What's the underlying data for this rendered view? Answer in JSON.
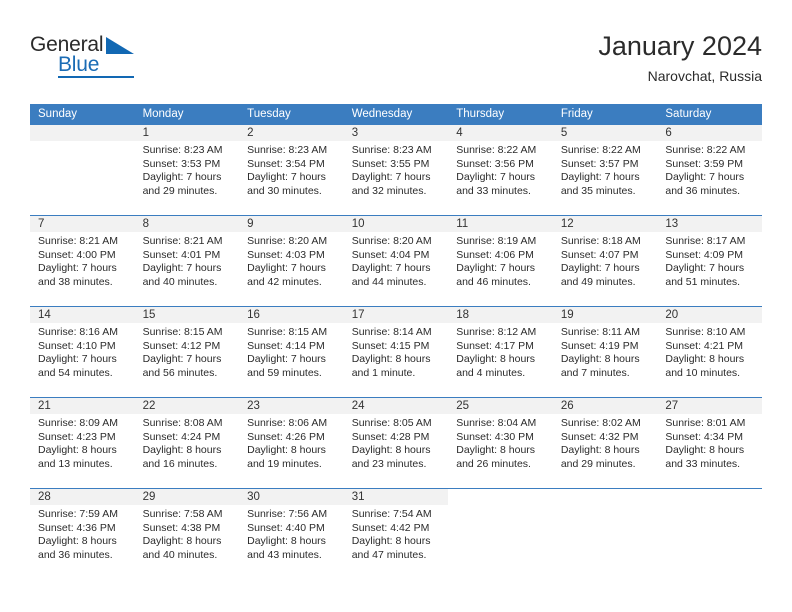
{
  "brand": {
    "general": "General",
    "blue": "Blue"
  },
  "header": {
    "title": "January 2024",
    "subtitle": "Narovchat, Russia"
  },
  "colors": {
    "header_blue": "#3b7dc0",
    "brand_blue": "#1268b3",
    "daynum_band": "#f2f2f2",
    "text": "#2b2b2b"
  },
  "calendar": {
    "weekday_headers": [
      "Sunday",
      "Monday",
      "Tuesday",
      "Wednesday",
      "Thursday",
      "Friday",
      "Saturday"
    ],
    "weeks": [
      [
        {
          "day": "",
          "lines": []
        },
        {
          "day": "1",
          "lines": [
            "Sunrise: 8:23 AM",
            "Sunset: 3:53 PM",
            "Daylight: 7 hours",
            "and 29 minutes."
          ]
        },
        {
          "day": "2",
          "lines": [
            "Sunrise: 8:23 AM",
            "Sunset: 3:54 PM",
            "Daylight: 7 hours",
            "and 30 minutes."
          ]
        },
        {
          "day": "3",
          "lines": [
            "Sunrise: 8:23 AM",
            "Sunset: 3:55 PM",
            "Daylight: 7 hours",
            "and 32 minutes."
          ]
        },
        {
          "day": "4",
          "lines": [
            "Sunrise: 8:22 AM",
            "Sunset: 3:56 PM",
            "Daylight: 7 hours",
            "and 33 minutes."
          ]
        },
        {
          "day": "5",
          "lines": [
            "Sunrise: 8:22 AM",
            "Sunset: 3:57 PM",
            "Daylight: 7 hours",
            "and 35 minutes."
          ]
        },
        {
          "day": "6",
          "lines": [
            "Sunrise: 8:22 AM",
            "Sunset: 3:59 PM",
            "Daylight: 7 hours",
            "and 36 minutes."
          ]
        }
      ],
      [
        {
          "day": "7",
          "lines": [
            "Sunrise: 8:21 AM",
            "Sunset: 4:00 PM",
            "Daylight: 7 hours",
            "and 38 minutes."
          ]
        },
        {
          "day": "8",
          "lines": [
            "Sunrise: 8:21 AM",
            "Sunset: 4:01 PM",
            "Daylight: 7 hours",
            "and 40 minutes."
          ]
        },
        {
          "day": "9",
          "lines": [
            "Sunrise: 8:20 AM",
            "Sunset: 4:03 PM",
            "Daylight: 7 hours",
            "and 42 minutes."
          ]
        },
        {
          "day": "10",
          "lines": [
            "Sunrise: 8:20 AM",
            "Sunset: 4:04 PM",
            "Daylight: 7 hours",
            "and 44 minutes."
          ]
        },
        {
          "day": "11",
          "lines": [
            "Sunrise: 8:19 AM",
            "Sunset: 4:06 PM",
            "Daylight: 7 hours",
            "and 46 minutes."
          ]
        },
        {
          "day": "12",
          "lines": [
            "Sunrise: 8:18 AM",
            "Sunset: 4:07 PM",
            "Daylight: 7 hours",
            "and 49 minutes."
          ]
        },
        {
          "day": "13",
          "lines": [
            "Sunrise: 8:17 AM",
            "Sunset: 4:09 PM",
            "Daylight: 7 hours",
            "and 51 minutes."
          ]
        }
      ],
      [
        {
          "day": "14",
          "lines": [
            "Sunrise: 8:16 AM",
            "Sunset: 4:10 PM",
            "Daylight: 7 hours",
            "and 54 minutes."
          ]
        },
        {
          "day": "15",
          "lines": [
            "Sunrise: 8:15 AM",
            "Sunset: 4:12 PM",
            "Daylight: 7 hours",
            "and 56 minutes."
          ]
        },
        {
          "day": "16",
          "lines": [
            "Sunrise: 8:15 AM",
            "Sunset: 4:14 PM",
            "Daylight: 7 hours",
            "and 59 minutes."
          ]
        },
        {
          "day": "17",
          "lines": [
            "Sunrise: 8:14 AM",
            "Sunset: 4:15 PM",
            "Daylight: 8 hours",
            "and 1 minute."
          ]
        },
        {
          "day": "18",
          "lines": [
            "Sunrise: 8:12 AM",
            "Sunset: 4:17 PM",
            "Daylight: 8 hours",
            "and 4 minutes."
          ]
        },
        {
          "day": "19",
          "lines": [
            "Sunrise: 8:11 AM",
            "Sunset: 4:19 PM",
            "Daylight: 8 hours",
            "and 7 minutes."
          ]
        },
        {
          "day": "20",
          "lines": [
            "Sunrise: 8:10 AM",
            "Sunset: 4:21 PM",
            "Daylight: 8 hours",
            "and 10 minutes."
          ]
        }
      ],
      [
        {
          "day": "21",
          "lines": [
            "Sunrise: 8:09 AM",
            "Sunset: 4:23 PM",
            "Daylight: 8 hours",
            "and 13 minutes."
          ]
        },
        {
          "day": "22",
          "lines": [
            "Sunrise: 8:08 AM",
            "Sunset: 4:24 PM",
            "Daylight: 8 hours",
            "and 16 minutes."
          ]
        },
        {
          "day": "23",
          "lines": [
            "Sunrise: 8:06 AM",
            "Sunset: 4:26 PM",
            "Daylight: 8 hours",
            "and 19 minutes."
          ]
        },
        {
          "day": "24",
          "lines": [
            "Sunrise: 8:05 AM",
            "Sunset: 4:28 PM",
            "Daylight: 8 hours",
            "and 23 minutes."
          ]
        },
        {
          "day": "25",
          "lines": [
            "Sunrise: 8:04 AM",
            "Sunset: 4:30 PM",
            "Daylight: 8 hours",
            "and 26 minutes."
          ]
        },
        {
          "day": "26",
          "lines": [
            "Sunrise: 8:02 AM",
            "Sunset: 4:32 PM",
            "Daylight: 8 hours",
            "and 29 minutes."
          ]
        },
        {
          "day": "27",
          "lines": [
            "Sunrise: 8:01 AM",
            "Sunset: 4:34 PM",
            "Daylight: 8 hours",
            "and 33 minutes."
          ]
        }
      ],
      [
        {
          "day": "28",
          "lines": [
            "Sunrise: 7:59 AM",
            "Sunset: 4:36 PM",
            "Daylight: 8 hours",
            "and 36 minutes."
          ]
        },
        {
          "day": "29",
          "lines": [
            "Sunrise: 7:58 AM",
            "Sunset: 4:38 PM",
            "Daylight: 8 hours",
            "and 40 minutes."
          ]
        },
        {
          "day": "30",
          "lines": [
            "Sunrise: 7:56 AM",
            "Sunset: 4:40 PM",
            "Daylight: 8 hours",
            "and 43 minutes."
          ]
        },
        {
          "day": "31",
          "lines": [
            "Sunrise: 7:54 AM",
            "Sunset: 4:42 PM",
            "Daylight: 8 hours",
            "and 47 minutes."
          ]
        },
        {
          "day": "",
          "lines": []
        },
        {
          "day": "",
          "lines": []
        },
        {
          "day": "",
          "lines": []
        }
      ]
    ]
  }
}
